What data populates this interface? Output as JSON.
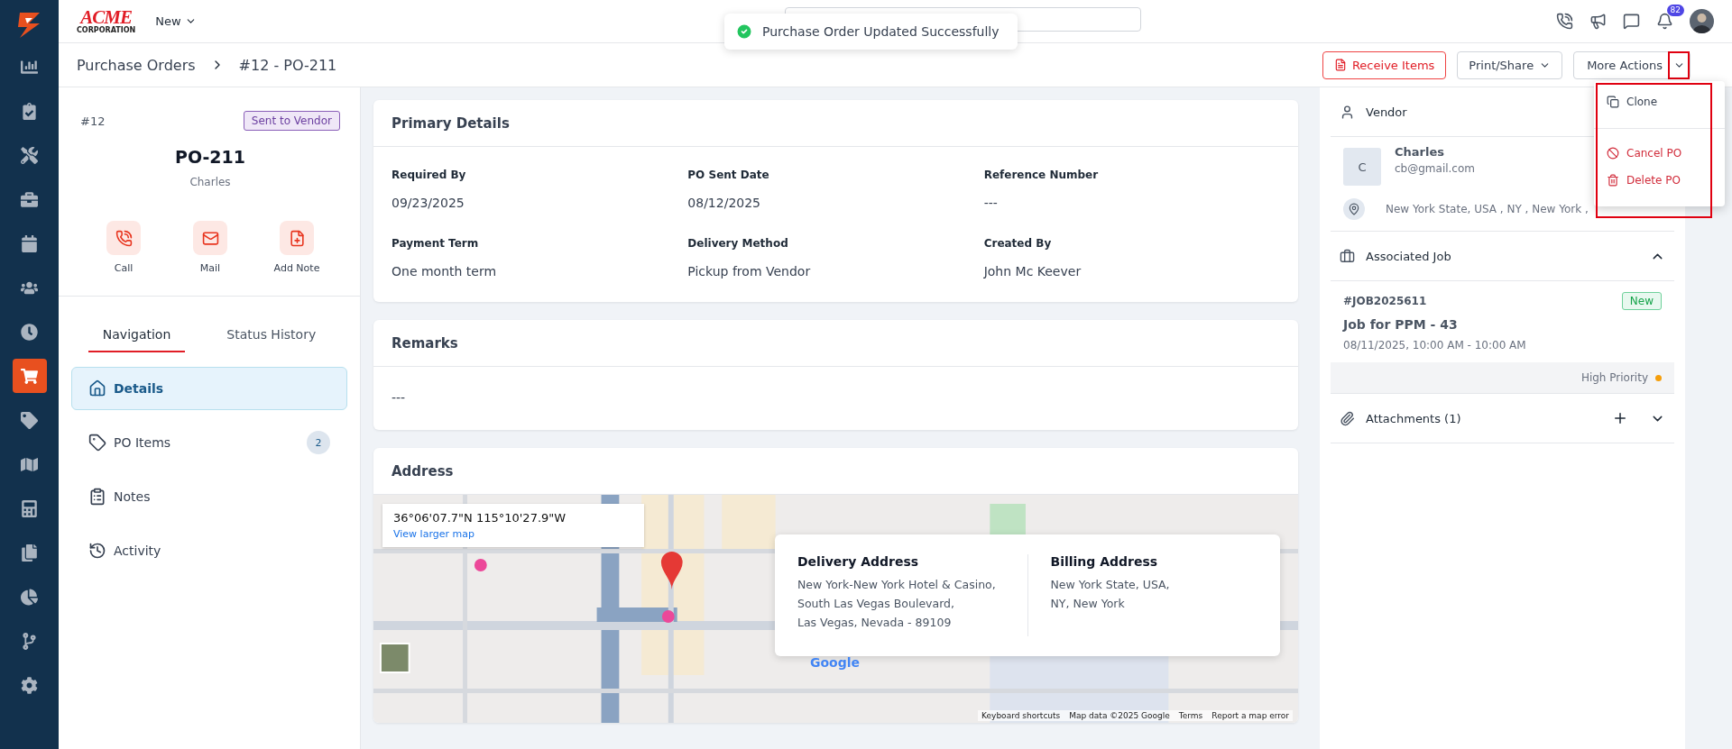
{
  "topbar": {
    "logo_word": "ACME",
    "logo_sub": "CORPORATION",
    "new_menu": "New",
    "notification_count": "82"
  },
  "toast": {
    "message": "Purchase Order Updated Successfully"
  },
  "sidebar": {
    "items": [
      {
        "selected": false
      },
      {
        "selected": false
      },
      {
        "selected": false
      },
      {
        "selected": false
      },
      {
        "selected": false
      },
      {
        "selected": false
      },
      {
        "selected": false
      },
      {
        "selected": true
      },
      {
        "selected": false
      },
      {
        "selected": false
      },
      {
        "selected": false
      },
      {
        "selected": false
      },
      {
        "selected": false
      },
      {
        "selected": false
      },
      {
        "selected": false
      }
    ]
  },
  "breadcrumb": [
    "Purchase Orders",
    "#12 - PO-211"
  ],
  "actions": {
    "receive": "Receive Items",
    "print": "Print/Share",
    "more": "More Actions"
  },
  "menu": {
    "items": [
      {
        "kind": "clone",
        "label": "Clone",
        "danger": false
      },
      {
        "kind": "cancel",
        "label": "Cancel PO",
        "danger": true
      },
      {
        "kind": "delete",
        "label": "Delete PO",
        "danger": true
      }
    ]
  },
  "summary": {
    "number": "#12",
    "status": "Sent to Vendor",
    "title": "PO-211",
    "vendor": "Charles",
    "quick_actions": [
      {
        "kind": "call",
        "label": "Call"
      },
      {
        "kind": "mail",
        "label": "Mail"
      },
      {
        "kind": "note",
        "label": "Add Note"
      }
    ]
  },
  "tabs": [
    {
      "label": "Navigation",
      "selected": true
    },
    {
      "label": "Status History",
      "selected": false
    }
  ],
  "nav": [
    {
      "kind": "home",
      "label": "Details",
      "selected": true
    },
    {
      "kind": "tag",
      "label": "PO Items",
      "count": "2",
      "selected": false
    },
    {
      "kind": "notes",
      "label": "Notes",
      "selected": false
    },
    {
      "kind": "history",
      "label": "Activity",
      "selected": false
    }
  ],
  "primary_details": {
    "title": "Primary Details",
    "fields": [
      {
        "label": "Required By",
        "value": "09/23/2025"
      },
      {
        "label": "PO Sent Date",
        "value": "08/12/2025"
      },
      {
        "label": "Reference Number",
        "value": "---"
      },
      {
        "label": "Payment Term",
        "value": "One month term"
      },
      {
        "label": "Delivery Method",
        "value": "Pickup from Vendor"
      },
      {
        "label": "Created By",
        "value": "John Mc Keever"
      }
    ]
  },
  "remarks": {
    "title": "Remarks",
    "text": "---"
  },
  "address": {
    "title": "Address",
    "coordinates": "36°06'07.7\"N 115°10'27.9\"W",
    "larger_map": "View larger map",
    "map_logo": "Google",
    "attribution": [
      "Keyboard shortcuts",
      "Map data ©2025 Google",
      "Terms",
      "Report a map error"
    ],
    "delivery": {
      "title": "Delivery Address",
      "lines": [
        "New York-New York Hotel & Casino,",
        "South Las Vegas Boulevard,",
        "Las Vegas, Nevada - 89109"
      ]
    },
    "billing": {
      "title": "Billing Address",
      "lines": [
        "New York State, USA,",
        "NY, New York"
      ]
    }
  },
  "vendor": {
    "title": "Vendor",
    "initial": "C",
    "name": "Charles",
    "email": "cb@gmail.com",
    "location": "New York State, USA , NY , New York ,"
  },
  "job": {
    "title": "Associated Job",
    "expanded": true,
    "number": "#JOB2025611",
    "status": "New",
    "name": "Job for PPM - 43",
    "time": "08/11/2025, 10:00 AM - 10:00 AM",
    "priority": "High Priority"
  },
  "attachments": {
    "title": "Attachments (1)",
    "expanded": false
  }
}
